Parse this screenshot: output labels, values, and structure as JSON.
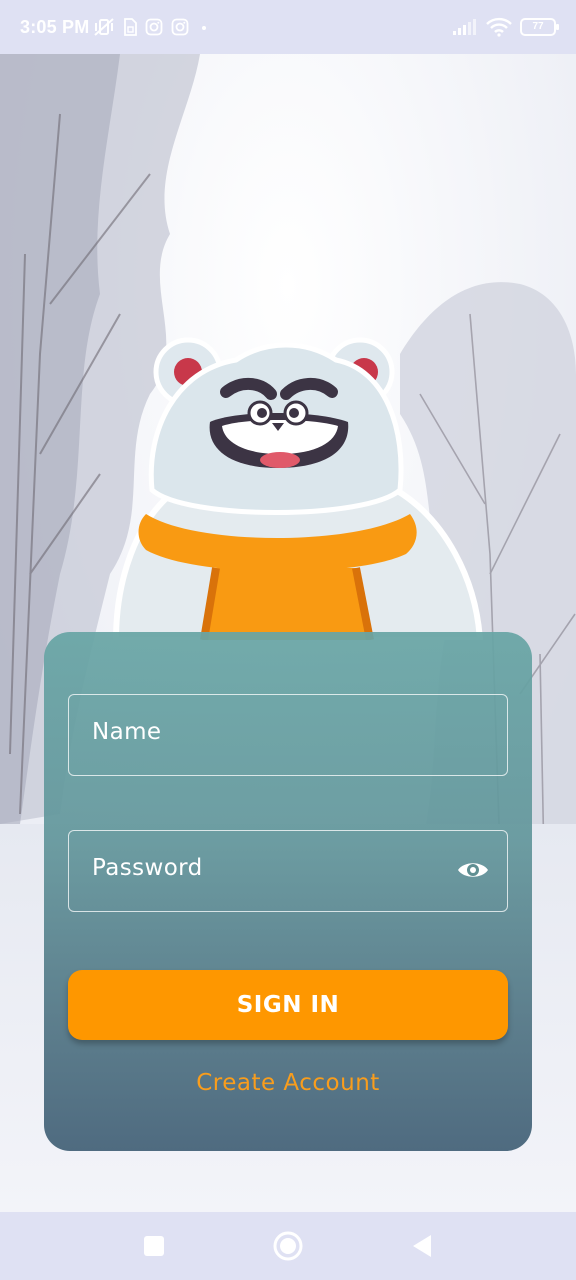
{
  "status_bar": {
    "time": "3:05 PM",
    "battery": "77",
    "icons": [
      "mute-vibrate-icon",
      "sim-icon",
      "instagram-icon",
      "instagram-icon",
      "dot-icon",
      "signal-icon",
      "wifi-icon",
      "battery-icon"
    ]
  },
  "login": {
    "name_placeholder": "Name",
    "password_placeholder": "Password",
    "password_toggle_icon": "eye-icon",
    "sign_in_label": "SIGN IN",
    "create_account_label": "Create Account"
  },
  "nav_bar": {
    "icons": [
      "square-recents-icon",
      "circle-home-icon",
      "triangle-back-icon"
    ]
  },
  "colors": {
    "accent": "#fe9700",
    "link": "#f99d1c",
    "card_top": "#68a5a5",
    "card_bottom": "#4f6b80",
    "system_bar": "#dfe1f3"
  }
}
